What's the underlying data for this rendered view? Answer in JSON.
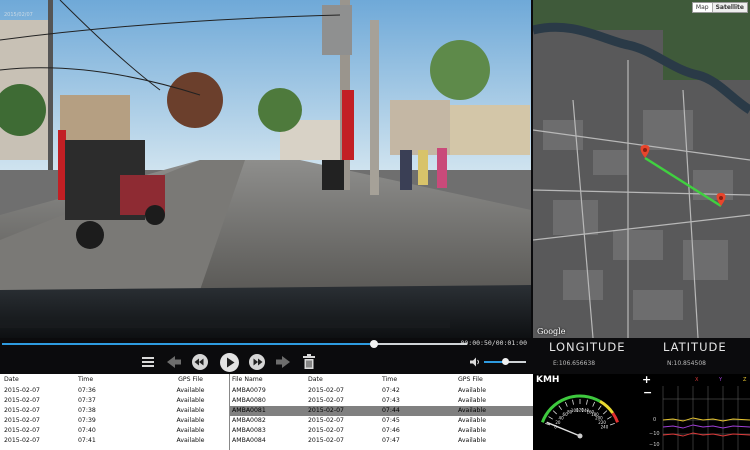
{
  "video": {
    "overlay_text": "2015/02/07"
  },
  "map": {
    "map_label": "Map",
    "satellite_label": "Satellite",
    "provider": "Google"
  },
  "player": {
    "time": "00:00:50/00:01:00",
    "progress": 0.8,
    "volume": 0.5
  },
  "coords": {
    "longitude_label": "LONGITUDE",
    "latitude_label": "LATITUDE",
    "longitude_value": "E:106.656638",
    "latitude_value": "N:10.854508"
  },
  "table_left": {
    "headers": [
      "Date",
      "Time",
      "GPS File"
    ],
    "rows": [
      [
        "2015-02-07",
        "07:36",
        "Available"
      ],
      [
        "2015-02-07",
        "07:37",
        "Available"
      ],
      [
        "2015-02-07",
        "07:38",
        "Available"
      ],
      [
        "2015-02-07",
        "07:39",
        "Available"
      ],
      [
        "2015-02-07",
        "07:40",
        "Available"
      ],
      [
        "2015-02-07",
        "07:41",
        "Available"
      ]
    ]
  },
  "table_right": {
    "headers": [
      "File Name",
      "Date",
      "Time",
      "GPS File"
    ],
    "selected_index": 2,
    "rows": [
      [
        "AMBA0079",
        "2015-02-07",
        "07:42",
        "Available"
      ],
      [
        "AMBA0080",
        "2015-02-07",
        "07:43",
        "Available"
      ],
      [
        "AMBA0081",
        "2015-02-07",
        "07:44",
        "Available"
      ],
      [
        "AMBA0082",
        "2015-02-07",
        "07:45",
        "Available"
      ],
      [
        "AMBA0083",
        "2015-02-07",
        "07:46",
        "Available"
      ],
      [
        "AMBA0084",
        "2015-02-07",
        "07:47",
        "Available"
      ]
    ]
  },
  "gauge": {
    "unit": "KMH",
    "ticks": [
      "0",
      "20",
      "40",
      "60",
      "80",
      "100",
      "120",
      "140",
      "160",
      "180",
      "200",
      "220",
      "240"
    ],
    "value": 4
  },
  "graph": {
    "plus": "+",
    "minus": "−",
    "legend": [
      "X",
      "Y",
      "Z"
    ],
    "y_labels": [
      "0",
      "−10",
      "−10"
    ]
  },
  "colors": {
    "accent": "#2e9be0",
    "route": "#40d040",
    "marker": "#e8452c"
  },
  "icons": [
    "playlist-icon",
    "prev-arrow-icon",
    "rewind-icon",
    "play-icon",
    "fast-forward-icon",
    "next-arrow-icon",
    "trash-icon",
    "volume-icon"
  ]
}
